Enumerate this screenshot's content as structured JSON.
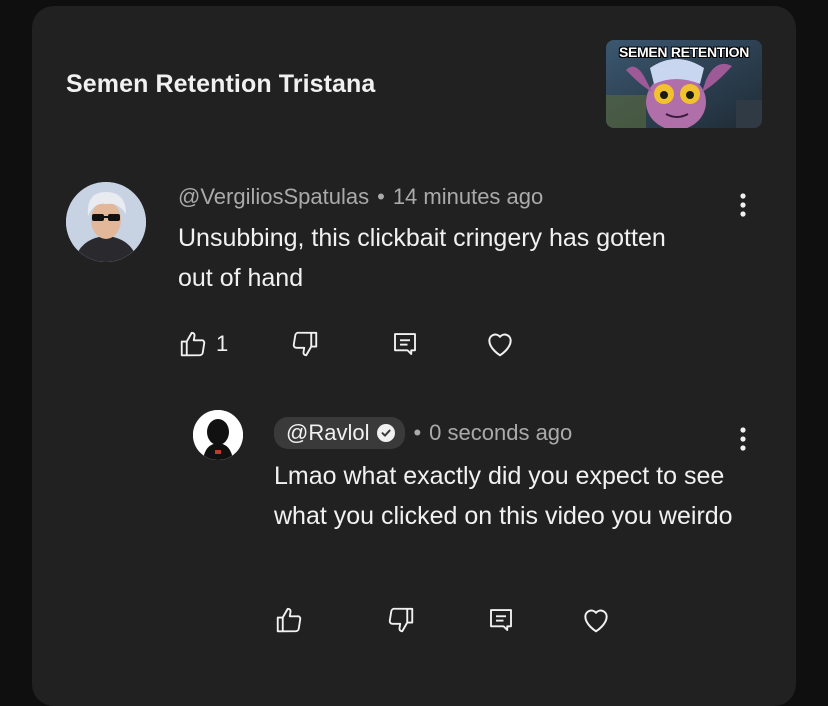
{
  "video": {
    "title": "Semen Retention Tristana",
    "thumbnail_text": "SEMEN RETENTION"
  },
  "comment": {
    "handle": "@VergiliosSpatulas",
    "separator": "•",
    "time": "14 minutes ago",
    "text": "Unsubbing, this clickbait cringery has gotten out of hand",
    "like_count": "1"
  },
  "reply": {
    "handle": "@Ravlol",
    "verified": true,
    "separator": "•",
    "time": "0 seconds ago",
    "text": "Lmao what exactly did you expect to see what you clicked on this video you weirdo"
  },
  "icons": {
    "like": "thumbs-up-icon",
    "dislike": "thumbs-down-icon",
    "reply": "reply-icon",
    "heart": "heart-icon",
    "more": "more-vert-icon"
  },
  "colors": {
    "background": "#0f0f0f",
    "card": "#212121",
    "text_primary": "#f1f1f1",
    "text_secondary": "#aaaaaa",
    "chip": "#3a3a3a"
  }
}
